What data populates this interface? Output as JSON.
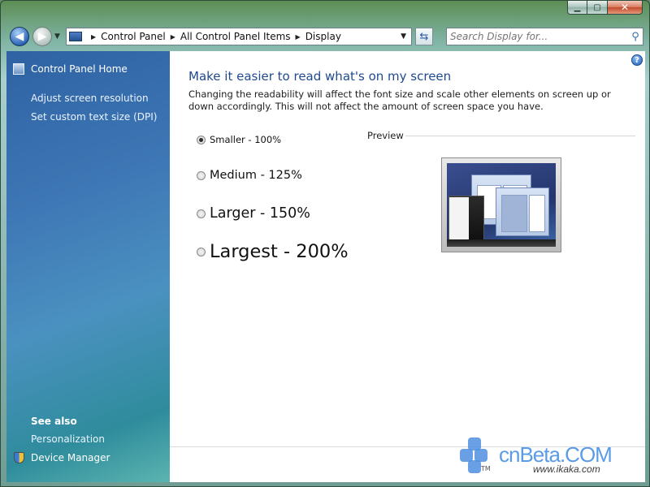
{
  "window": {
    "caption": {
      "minimize_glyph": "▁",
      "maximize_glyph": "▢",
      "close_glyph": "✕"
    }
  },
  "nav": {
    "back_glyph": "◀",
    "forward_glyph": "▶",
    "breadcrumb": [
      "Control Panel",
      "All Control Panel Items",
      "Display"
    ],
    "separator_glyph": "▶",
    "dropdown_glyph": "▼",
    "refresh_glyph": "⇆"
  },
  "search": {
    "placeholder": "Search Display for..."
  },
  "sidebar": {
    "home": "Control Panel Home",
    "links": [
      "Adjust screen resolution",
      "Set custom text size (DPI)"
    ],
    "see_also_heading": "See also",
    "see_also": [
      "Personalization",
      "Device Manager"
    ]
  },
  "main": {
    "help_glyph": "?",
    "title": "Make it easier to read what's on my screen",
    "description": "Changing the readability will affect the font size and scale other elements on screen up or down accordingly. This will not affect the amount of screen space you have.",
    "options": [
      {
        "label": "Smaller - 100%",
        "checked": true
      },
      {
        "label": "Medium - 125%",
        "checked": false
      },
      {
        "label": "Larger - 150%",
        "checked": false
      },
      {
        "label": "Largest - 200%",
        "checked": false
      }
    ],
    "preview_label": "Preview"
  },
  "watermark": {
    "brand": "cnBeta.COM",
    "tm": "TM",
    "url": "www.ikaka.com"
  },
  "colors": {
    "title_blue": "#1f4a8f",
    "sidebar_top": "#2e62a3",
    "sidebar_bottom": "#5bb4b0"
  }
}
